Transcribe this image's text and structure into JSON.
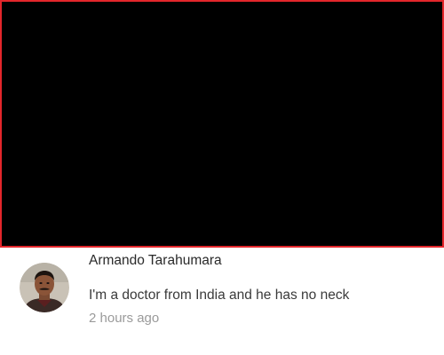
{
  "video": {
    "state": "blank"
  },
  "comment": {
    "author": "Armando Tarahumara",
    "text": "I'm a doctor from India and he has no neck",
    "timestamp": "2 hours ago",
    "avatar_icon": "user-avatar-photo"
  },
  "colors": {
    "frame_border": "#e3262b",
    "video_background": "#000000",
    "author_text": "#2a2a2a",
    "timestamp_text": "#9a9a9a"
  }
}
